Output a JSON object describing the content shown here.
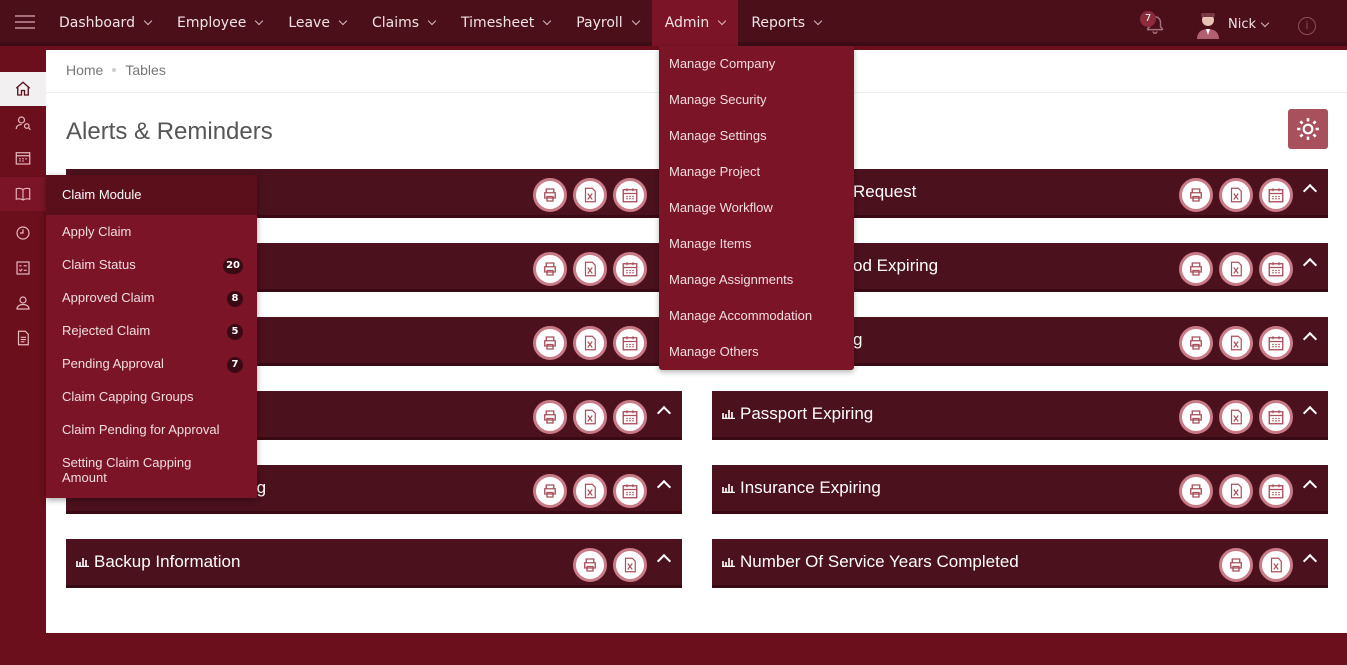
{
  "topnav": {
    "menu": [
      {
        "label": "Dashboard"
      },
      {
        "label": "Employee"
      },
      {
        "label": "Leave"
      },
      {
        "label": "Claims"
      },
      {
        "label": "Timesheet"
      },
      {
        "label": "Payroll"
      },
      {
        "label": "Admin"
      },
      {
        "label": "Reports"
      }
    ],
    "notification_count": "7",
    "user_name": "Nick",
    "info_glyph": "i"
  },
  "breadcrumb": {
    "home": "Home",
    "current": "Tables"
  },
  "page_title": "Alerts & Reminders",
  "admin_menu": [
    "Manage Company",
    "Manage Security",
    "Manage Settings",
    "Manage Project",
    "Manage Workflow",
    "Manage Items",
    "Manage Assignments",
    "Manage Accommodation",
    "Manage Others"
  ],
  "claim_menu": {
    "header": "Claim Module",
    "items": [
      {
        "label": "Apply Claim",
        "count": ""
      },
      {
        "label": "Claim Status",
        "count": "20"
      },
      {
        "label": "Approved Claim",
        "count": "8"
      },
      {
        "label": "Rejected Claim",
        "count": "5"
      },
      {
        "label": "Pending Approval",
        "count": "7"
      },
      {
        "label": "Claim Capping Groups",
        "count": ""
      },
      {
        "label": "Claim Pending for Approval",
        "count": ""
      },
      {
        "label": "Setting Claim Capping",
        "label2": "Amount",
        "count": ""
      }
    ]
  },
  "panels": {
    "right1": "Request",
    "left5": "iring",
    "right2": "od Expiring",
    "right3": "g",
    "right4": "Passport Expiring",
    "right5": "Insurance Expiring",
    "left6": "Backup Information",
    "right6": "Number Of Service Years Completed"
  },
  "colors": {
    "primary": "#4b111d",
    "accent": "#7b1426",
    "sidebar": "#6b0f1c",
    "button_ring": "#c97b87"
  },
  "icons": {
    "print": "printer-icon",
    "excel": "excel-icon",
    "calendar": "calendar-icon",
    "collapse": "chevron-up-icon"
  }
}
